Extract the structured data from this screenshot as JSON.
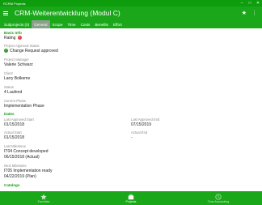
{
  "window": {
    "title": "RCRM Projects"
  },
  "colors": {
    "accent": "#1aa81a",
    "section": "#1a9b1a",
    "alert": "#e04444"
  },
  "header": {
    "title": "CRM-Weiterentwicklung (Modul C)"
  },
  "tabs": [
    {
      "label": "Subprojects (0)"
    },
    {
      "label": "General"
    },
    {
      "label": "Scope"
    },
    {
      "label": "Time"
    },
    {
      "label": "Costs"
    },
    {
      "label": "Benefits"
    },
    {
      "label": "Effort"
    }
  ],
  "basic_info": {
    "section_title": "Basic Info",
    "rating_label": "Rating",
    "rating_badge": "!",
    "approval_status_label": "Project Approval Status",
    "approval_status_value": "Change Request approved",
    "manager_label": "Project Manager",
    "manager_value": "Valerie Schwarz",
    "client_label": "Client",
    "client_value": "Larry Bolkeme",
    "status_label": "Status",
    "status_value": "4 Laufend",
    "phase_label": "Current Phase",
    "phase_value": "Implementation Phase"
  },
  "dates": {
    "section_title": "Dates",
    "last_approved_start_label": "Last Approved Start",
    "last_approved_start_value": "01/15/2018",
    "last_approved_end_label": "Last Approved End",
    "last_approved_end_value": "07/15/2019",
    "actual_start_label": "Actual Start",
    "actual_start_value": "01/15/2018",
    "actual_end_label": "Actual End",
    "actual_end_value": "-",
    "last_milestone_label": "Last Milestone",
    "last_milestone_value": "IT04 Concept developed",
    "last_milestone_date": "06/15/2018 (Actual)",
    "next_milestone_label": "Next Milestone",
    "next_milestone_value": "IT05 Implementation ready",
    "next_milestone_date": "04/22/2019 (Plan)"
  },
  "catalogs": {
    "section_title": "Catalogs"
  },
  "bottom_nav": [
    {
      "label": "Favorites",
      "icon": "star-icon"
    },
    {
      "label": "Projects",
      "icon": "briefcase-icon"
    },
    {
      "label": "Time Accounting",
      "icon": "clock-icon"
    }
  ]
}
